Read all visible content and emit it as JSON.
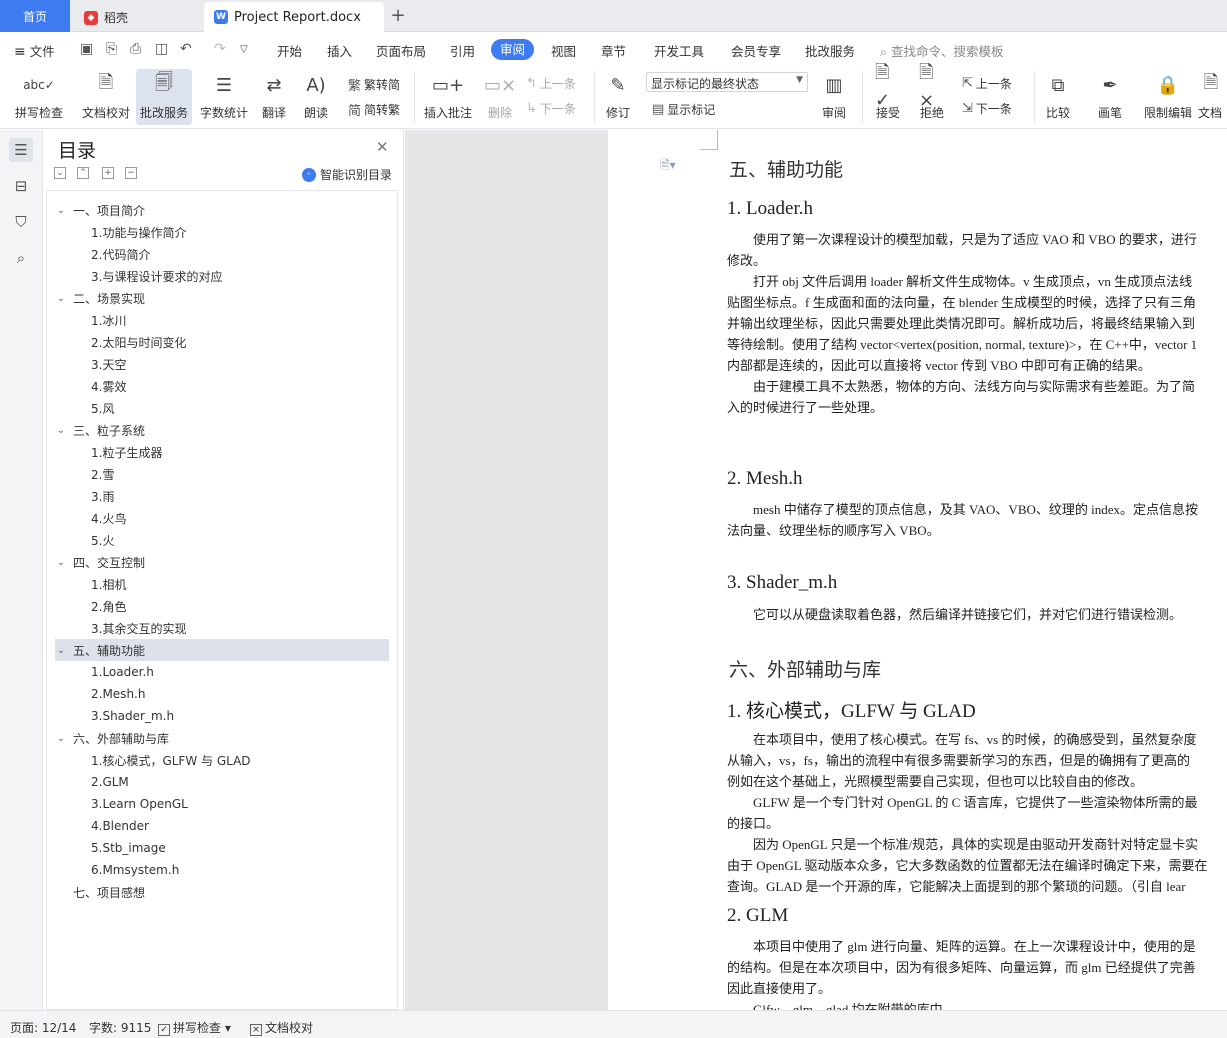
{
  "tabs": {
    "home": "首页",
    "daoke": "稻壳",
    "doc": "Project Report.docx",
    "add": "+"
  },
  "menu": {
    "file": "文件",
    "items": [
      "开始",
      "插入",
      "页面布局",
      "引用",
      "审阅",
      "视图",
      "章节",
      "开发工具",
      "会员专享",
      "批改服务"
    ],
    "active": "审阅",
    "search": "查找命令、搜索模板"
  },
  "ribbon": {
    "spell": "拼写检查",
    "proof": "文档校对",
    "review_service": "批改服务",
    "word_count": "字数统计",
    "translate": "翻译",
    "read": "朗读",
    "trad_to_simp": "繁转简",
    "simp_to_trad": "简转繁",
    "insert_comment": "插入批注",
    "delete": "删除",
    "prev": "上一条",
    "next": "下一条",
    "track": "修订",
    "markup_mode": "显示标记的最终状态",
    "show_markup": "显示标记",
    "review": "审阅",
    "accept": "接受",
    "reject": "拒绝",
    "prev2": "上一条",
    "next2": "下一条",
    "compare": "比较",
    "pen": "画笔",
    "restrict": "限制编辑",
    "doc_cut": "文档"
  },
  "toc": {
    "title": "目录",
    "smart": "智能识别目录",
    "items": [
      {
        "level": 1,
        "text": "一、项目简介",
        "expanded": true
      },
      {
        "level": 2,
        "text": "1.功能与操作简介"
      },
      {
        "level": 2,
        "text": "2.代码简介"
      },
      {
        "level": 2,
        "text": "3.与课程设计要求的对应"
      },
      {
        "level": 1,
        "text": "二、场景实现",
        "expanded": true
      },
      {
        "level": 2,
        "text": "1.冰川"
      },
      {
        "level": 2,
        "text": "2.太阳与时间变化"
      },
      {
        "level": 2,
        "text": "3.天空"
      },
      {
        "level": 2,
        "text": "4.雾效"
      },
      {
        "level": 2,
        "text": "5.风"
      },
      {
        "level": 1,
        "text": "三、粒子系统",
        "expanded": true
      },
      {
        "level": 2,
        "text": "1.粒子生成器"
      },
      {
        "level": 2,
        "text": "2.雪"
      },
      {
        "level": 2,
        "text": "3.雨"
      },
      {
        "level": 2,
        "text": "4.火鸟"
      },
      {
        "level": 2,
        "text": "5.火"
      },
      {
        "level": 1,
        "text": "四、交互控制",
        "expanded": true
      },
      {
        "level": 2,
        "text": "1.相机"
      },
      {
        "level": 2,
        "text": "2.角色"
      },
      {
        "level": 2,
        "text": "3.其余交互的实现"
      },
      {
        "level": 1,
        "text": "五、辅助功能",
        "expanded": true,
        "selected": true
      },
      {
        "level": 2,
        "text": "1.Loader.h"
      },
      {
        "level": 2,
        "text": "2.Mesh.h"
      },
      {
        "level": 2,
        "text": "3.Shader_m.h"
      },
      {
        "level": 1,
        "text": "六、外部辅助与库",
        "expanded": true
      },
      {
        "level": 2,
        "text": "1.核心模式，GLFW 与 GLAD"
      },
      {
        "level": 2,
        "text": "2.GLM"
      },
      {
        "level": 2,
        "text": "3.Learn OpenGL"
      },
      {
        "level": 2,
        "text": "4.Blender"
      },
      {
        "level": 2,
        "text": "5.Stb_image"
      },
      {
        "level": 2,
        "text": "6.Mmsystem.h"
      },
      {
        "level": 1,
        "text": "七、项目感想",
        "expanded": false
      }
    ]
  },
  "doc": {
    "h5": "五、辅助功能",
    "loader_h": "1. Loader.h",
    "loader_p": [
      "使用了第一次课程设计的模型加载，只是为了适应 VAO 和 VBO 的要求，进行",
      "修改。",
      "打开 obj 文件后调用 loader 解析文件生成物体。v 生成顶点，vn 生成顶点法线",
      "贴图坐标点。f 生成面和面的法向量，在 blender 生成模型的时候，选择了只有三角",
      "并输出纹理坐标，因此只需要处理此类情况即可。解析成功后，将最终结果输入到",
      "等待绘制。使用了结构 vector<vertex(position, normal, texture)>，在 C++中，vector 1",
      "内部都是连续的，因此可以直接将 vector 传到 VBO 中即可有正确的结果。",
      "由于建模工具不太熟悉，物体的方向、法线方向与实际需求有些差距。为了简",
      "入的时候进行了一些处理。"
    ],
    "mesh_h": "2. Mesh.h",
    "mesh_p": [
      "mesh 中储存了模型的顶点信息，及其 VAO、VBO、纹理的 index。定点信息按",
      "法向量、纹理坐标的顺序写入 VBO。"
    ],
    "shader_h": "3. Shader_m.h",
    "shader_p": [
      "它可以从硬盘读取着色器，然后编译并链接它们，并对它们进行错误检测。"
    ],
    "h6": "六、外部辅助与库",
    "core_h": "1. 核心模式，GLFW 与 GLAD",
    "core_p": [
      "在本项目中，使用了核心模式。在写 fs、vs 的时候，的确感受到，虽然复杂度",
      "从输入，vs，fs，输出的流程中有很多需要新学习的东西，但是的确拥有了更高的",
      "例如在这个基础上，光照模型需要自己实现，但也可以比较自由的修改。",
      "GLFW 是一个专门针对 OpenGL 的 C 语言库，它提供了一些渲染物体所需的最",
      "的接口。",
      "因为 OpenGL 只是一个标准/规范，具体的实现是由驱动开发商针对特定显卡实",
      "由于 OpenGL 驱动版本众多，它大多数函数的位置都无法在编译时确定下来，需要在",
      "查询。GLAD 是一个开源的库，它能解决上面提到的那个繁琐的问题。（引自 lear"
    ],
    "glm_h": "2. GLM",
    "glm_p": [
      "本项目中使用了 glm 进行向量、矩阵的运算。在上一次课程设计中，使用的是",
      "的结构。但是在本次项目中，因为有很多矩阵、向量运算，而 glm 已经提供了完善",
      "因此直接使用了。",
      "Glfw、glm、glad 均在附带的库中。"
    ]
  },
  "status": {
    "page": "页面: 12/14",
    "words": "字数: 9115",
    "spell": "拼写检查",
    "proof": "文档校对"
  }
}
